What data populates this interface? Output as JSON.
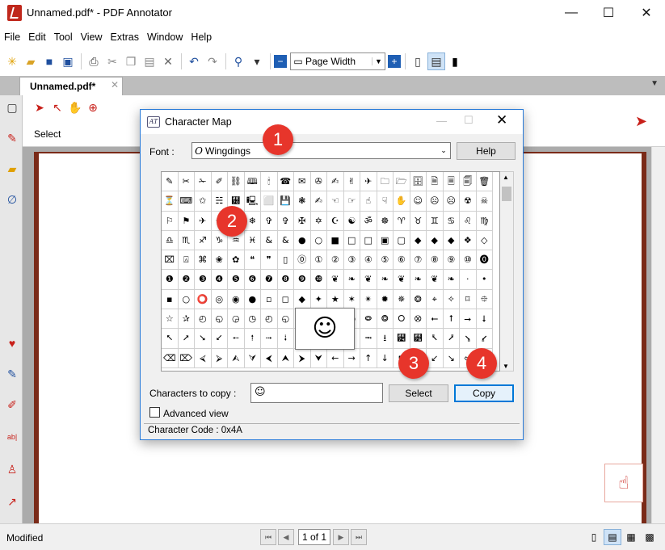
{
  "window": {
    "title": "Unnamed.pdf* - PDF Annotator",
    "minimize": "—",
    "maximize": "☐",
    "close": "✕"
  },
  "menu": [
    "File",
    "Edit",
    "Tool",
    "View",
    "Extras",
    "Window",
    "Help"
  ],
  "toolbar": {
    "zoom_value": "Page Width"
  },
  "tab": {
    "label": "Unnamed.pdf*",
    "close": "✕"
  },
  "annotation_bar": {
    "select_label": "Select"
  },
  "dialog": {
    "title": "Character Map",
    "font_label": "Font :",
    "font_value": "Wingdings",
    "help_label": "Help",
    "grid": [
      [
        "✎",
        "✂",
        "✁",
        "✐",
        "⛓",
        "🕮",
        "🕯",
        "☎",
        "✉",
        "✇",
        "✍",
        "✌",
        "✈",
        "🗀",
        "🗁",
        "🗄",
        "🗎",
        "🗏",
        "🗐",
        "🗑"
      ],
      [
        "⏳",
        "⌨",
        "✩",
        "☵",
        "⹰",
        "🖳",
        "⬜",
        "💾",
        "❃",
        "✍",
        "☜",
        "☞",
        "☝",
        "☟",
        "✋",
        "☺",
        "☹",
        "☹",
        "☢",
        "☠"
      ],
      [
        "⚐",
        "⚑",
        "✈",
        "☼",
        "☂",
        "❄",
        "✞",
        "✞",
        "✠",
        "✡",
        "☪",
        "☯",
        "ॐ",
        "☸",
        "♈",
        "♉",
        "♊",
        "♋",
        "♌",
        "♍"
      ],
      [
        "♎",
        "♏",
        "♐",
        "♑",
        "♒",
        "♓",
        "&",
        "&",
        "●",
        "○",
        "■",
        "□",
        "□",
        "▣",
        "▢",
        "◆",
        "◆",
        "◆",
        "❖",
        "◇"
      ],
      [
        "⌧",
        "⍓",
        "⌘",
        "❀",
        "✿",
        "❝",
        "❞",
        "▯",
        "⓪",
        "①",
        "②",
        "③",
        "④",
        "⑤",
        "⑥",
        "⑦",
        "⑧",
        "⑨",
        "⑩",
        "⓿"
      ],
      [
        "❶",
        "❷",
        "❸",
        "❹",
        "❺",
        "❻",
        "❼",
        "❽",
        "❾",
        "❿",
        "❦",
        "❧",
        "❦",
        "❧",
        "❦",
        "❧",
        "❦",
        "❧",
        "·",
        "•"
      ],
      [
        "▪",
        "○",
        "⭕",
        "◎",
        "◉",
        "●",
        "▫",
        "◻",
        "◆",
        "✦",
        "★",
        "✶",
        "✴",
        "✹",
        "✵",
        "❂",
        "⌖",
        "✧",
        "⌑",
        "⯐"
      ],
      [
        "☆",
        "✰",
        "◴",
        "◵",
        "◶",
        "◷",
        "◴",
        "◵",
        "◶",
        "◷",
        "◴",
        "◵",
        "⭖",
        "⭗",
        "⭘",
        "⭙",
        "⭠",
        "⭡",
        "⭢",
        "⭣"
      ],
      [
        "⭦",
        "⭧",
        "⭨",
        "⭩",
        "⭪",
        "⭫",
        "⭬",
        "⭭",
        "⭮",
        "⭯",
        "⭰",
        "⭱",
        "⭲",
        "⭳",
        "⭴",
        "⭵",
        "⭶",
        "⭷",
        "⭸",
        "⭹"
      ],
      [
        "⌫",
        "⌦",
        "⮘",
        "⮚",
        "⮙",
        "⮛",
        "⮜",
        "⮝",
        "⮞",
        "⮟",
        "←",
        "→",
        "↑",
        "↓",
        "↖",
        "↗",
        "↙",
        "↘",
        "⬄",
        "⇨"
      ]
    ],
    "magnified_char": "☺",
    "copy_label": "Characters to copy :",
    "copy_value": "☺",
    "select_label": "Select",
    "copy_button_label": "Copy",
    "advanced_label": "Advanced view",
    "status": "Character Code : 0x4A"
  },
  "callouts": [
    "1",
    "2",
    "3",
    "4"
  ],
  "statusbar": {
    "text": "Modified",
    "page_value": "1 of 1"
  },
  "colors": {
    "accent_red": "#e7352b",
    "brand_red": "#c8201a",
    "focus_blue": "#0078d7"
  }
}
